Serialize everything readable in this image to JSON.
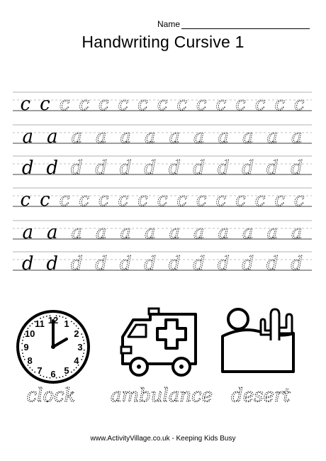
{
  "header": {
    "name_label": "Name",
    "title": "Handwriting Cursive 1"
  },
  "practice_rows": [
    {
      "letter": "c",
      "count": 15
    },
    {
      "letter": "a",
      "count": 12
    },
    {
      "letter": "d",
      "count": 12
    },
    {
      "letter": "c",
      "count": 15
    },
    {
      "letter": "a",
      "count": 12
    },
    {
      "letter": "d",
      "count": 12
    }
  ],
  "pictures": [
    {
      "icon": "clock-icon",
      "word": "clock",
      "clock_numbers": [
        "12",
        "1",
        "2",
        "3",
        "4",
        "5",
        "6",
        "7",
        "8",
        "9",
        "10",
        "11"
      ]
    },
    {
      "icon": "ambulance-icon",
      "word": "ambulance"
    },
    {
      "icon": "desert-icon",
      "word": "desert"
    }
  ],
  "footer": {
    "text": "www.ActivityVillage.co.uk - Keeping Kids Busy"
  }
}
